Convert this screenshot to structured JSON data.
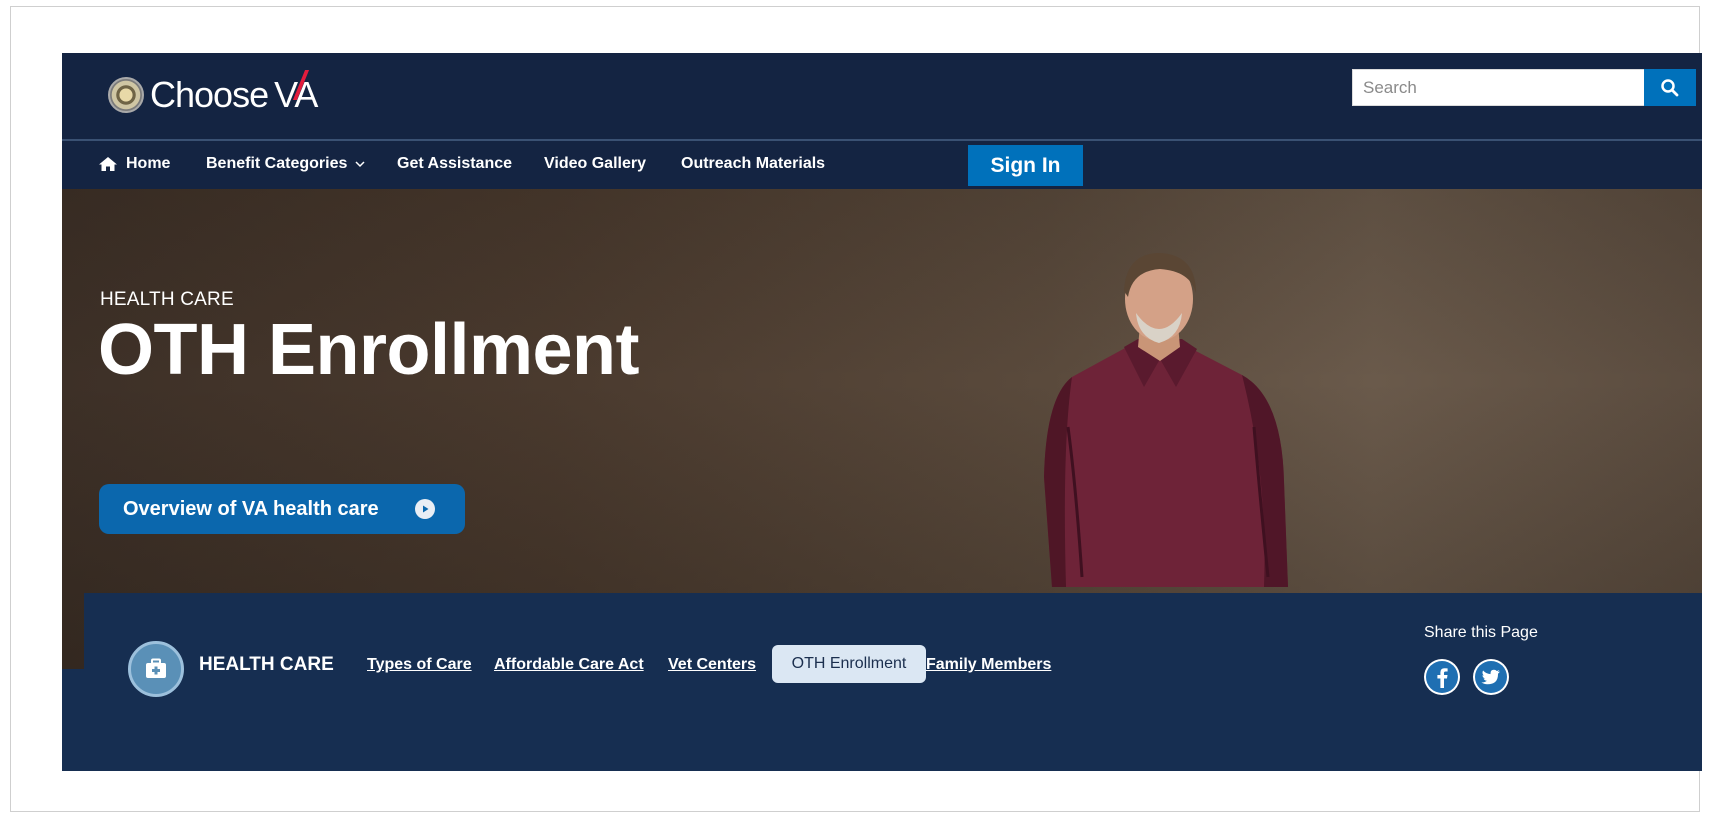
{
  "header": {
    "logo_text": "Choose VA",
    "logo_word": "Choose",
    "logo_brand": "VA",
    "search": {
      "placeholder": "Search"
    }
  },
  "nav": {
    "items": [
      {
        "label": "Home",
        "icon": "home-icon"
      },
      {
        "label": "Benefit Categories",
        "icon": "chevron-down-icon"
      },
      {
        "label": "Get Assistance"
      },
      {
        "label": "Video Gallery"
      },
      {
        "label": "Outreach Materials"
      }
    ],
    "sign_in": "Sign In"
  },
  "hero": {
    "kicker": "HEALTH CARE",
    "title": "OTH Enrollment",
    "cta": "Overview of VA health care"
  },
  "subnav": {
    "section_title": "HEALTH CARE",
    "links": [
      {
        "label": "Types of Care"
      },
      {
        "label": "Affordable Care Act"
      },
      {
        "label": "Vet Centers"
      },
      {
        "label": "OTH Enrollment",
        "active": true
      },
      {
        "label": "Family Members"
      }
    ],
    "share_label": "Share this Page",
    "social": [
      "facebook-icon",
      "twitter-icon"
    ]
  },
  "colors": {
    "header_bg": "#142442",
    "accent_blue": "#0071bb",
    "brand_red": "#e31c3d",
    "subnav_bg": "#162e51",
    "active_pill": "#dbe7f3"
  }
}
